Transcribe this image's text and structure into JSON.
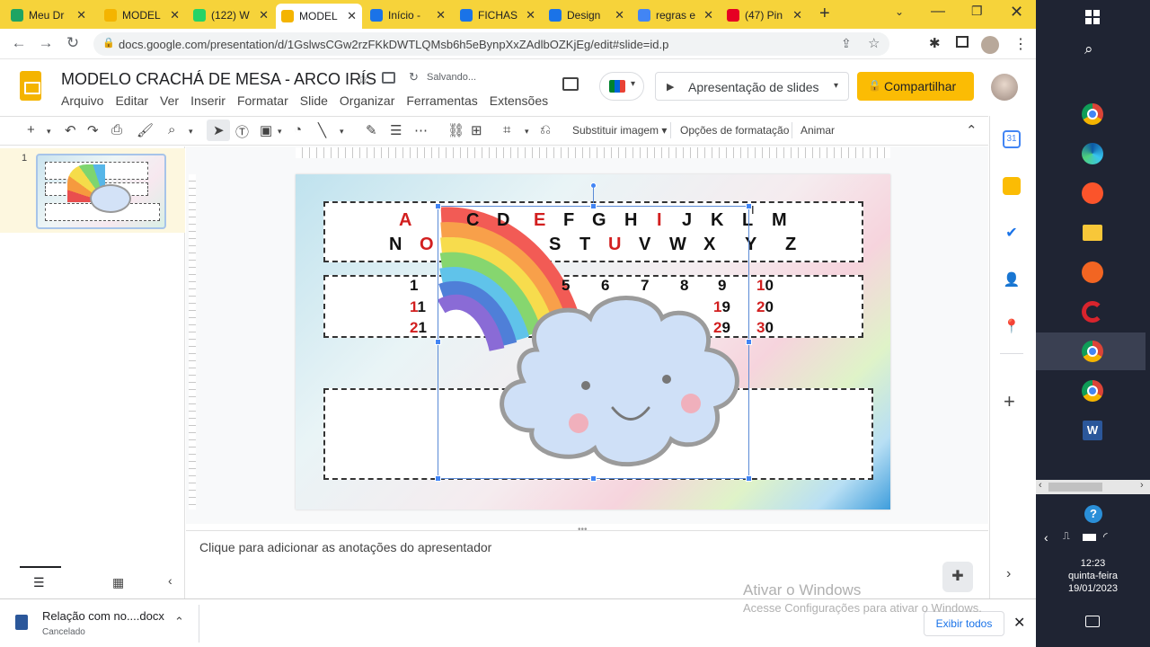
{
  "browser": {
    "tabs": [
      {
        "title": "Meu Dr",
        "favicon_color": "#1fa463",
        "active": false
      },
      {
        "title": "MODEL",
        "favicon_color": "#f4b400",
        "active": false
      },
      {
        "title": "(122) W",
        "favicon_color": "#25d366",
        "active": false
      },
      {
        "title": "MODEL",
        "favicon_color": "#f4b400",
        "active": true
      },
      {
        "title": "Início -",
        "favicon_color": "#1a73e8",
        "active": false
      },
      {
        "title": "FICHAS",
        "favicon_color": "#1a73e8",
        "active": false
      },
      {
        "title": "Design",
        "favicon_color": "#1a73e8",
        "active": false
      },
      {
        "title": "regras e",
        "favicon_color": "#4285f4",
        "active": false
      },
      {
        "title": "(47) Pin",
        "favicon_color": "#e60023",
        "active": false
      }
    ],
    "new_tab_label": "+",
    "url": "docs.google.com/presentation/d/1GslwsCGw2rzFKkDWTLQMsb6h5eBynpXxZAdlbOZKjEg/edit#slide=id.p"
  },
  "app": {
    "doc_title": "MODELO CRACHÁ DE MESA - ARCO IRÍS",
    "save_status": "Salvando...",
    "menus": [
      "Arquivo",
      "Editar",
      "Ver",
      "Inserir",
      "Formatar",
      "Slide",
      "Organizar",
      "Ferramentas",
      "Extensões"
    ],
    "present_label": "Apresentação de slides",
    "share_label": "Compartilhar",
    "share_color": "#fbbc04"
  },
  "toolbar": {
    "replace_image": "Substituir imagem",
    "format_options": "Opções de formatação",
    "animate": "Animar"
  },
  "filmstrip": {
    "slide_number": "1"
  },
  "slide": {
    "alphabet_row1": [
      {
        "t": "A",
        "red": true
      },
      {
        "t": "C",
        "red": false
      },
      {
        "t": "D",
        "red": false
      },
      {
        "t": "E",
        "red": true
      },
      {
        "t": "F",
        "red": false
      },
      {
        "t": "G",
        "red": false
      },
      {
        "t": "H",
        "red": false
      },
      {
        "t": "I",
        "red": true
      },
      {
        "t": "J",
        "red": false
      },
      {
        "t": "K",
        "red": false
      },
      {
        "t": "L",
        "red": false
      },
      {
        "t": "M",
        "red": false
      }
    ],
    "alphabet_row2": [
      {
        "t": "N",
        "red": false
      },
      {
        "t": "O",
        "red": true
      },
      {
        "t": "S",
        "red": false
      },
      {
        "t": "T",
        "red": false
      },
      {
        "t": "U",
        "red": true
      },
      {
        "t": "V",
        "red": false
      },
      {
        "t": "W",
        "red": false
      },
      {
        "t": "X",
        "red": false
      },
      {
        "t": "Y",
        "red": false
      },
      {
        "t": "Z",
        "red": false
      }
    ],
    "numbers": [
      "1",
      "5",
      "6",
      "7",
      "8",
      "9",
      "10",
      "11",
      "19",
      "20",
      "21",
      "29",
      "30"
    ]
  },
  "notes_placeholder": "Clique para adicionar as anotações do apresentador",
  "downloads": {
    "file": "Relação com no....docx",
    "status": "Cancelado",
    "show_all": "Exibir todos"
  },
  "watermark": {
    "line1": "Ativar o Windows",
    "line2": "Acesse Configurações para ativar o Windows."
  },
  "taskbar": {
    "time": "12:23",
    "weekday": "quinta-feira",
    "date": "19/01/2023"
  }
}
